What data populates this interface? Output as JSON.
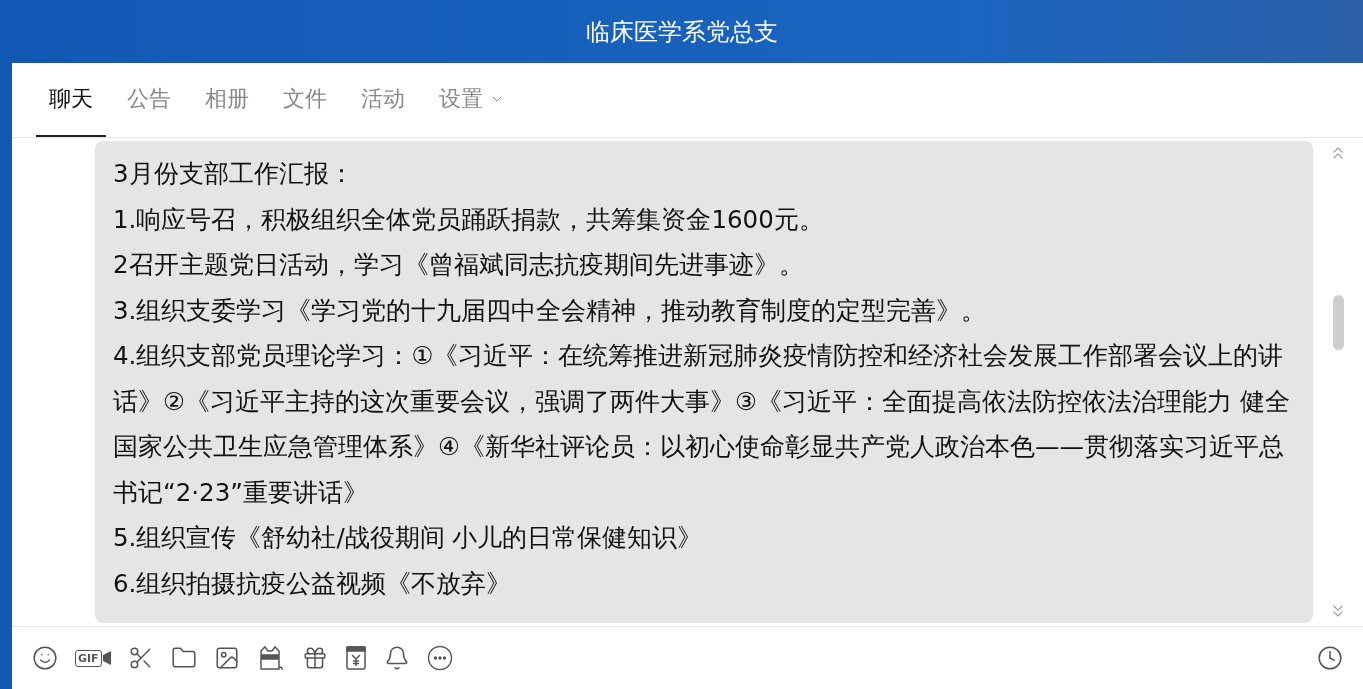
{
  "window": {
    "title": "临床医学系党总支"
  },
  "tabs": [
    {
      "label": "聊天",
      "selected": true,
      "dropdown": false
    },
    {
      "label": "公告",
      "selected": false,
      "dropdown": false
    },
    {
      "label": "相册",
      "selected": false,
      "dropdown": false
    },
    {
      "label": "文件",
      "selected": false,
      "dropdown": false
    },
    {
      "label": "活动",
      "selected": false,
      "dropdown": false
    },
    {
      "label": "设置",
      "selected": false,
      "dropdown": true
    }
  ],
  "message": {
    "lines": [
      "3月份支部工作汇报：",
      "1.响应号召，积极组织全体党员踊跃捐款，共筹集资金1600元。",
      "2召开主题党日活动，学习《曾福斌同志抗疫期间先进事迹》。",
      "3.组织支委学习《学习党的十九届四中全会精神，推动教育制度的定型完善》。",
      "4.组织支部党员理论学习：①《习近平：在统筹推进新冠肺炎疫情防控和经济社会发展工作部署会议上的讲话》②《习近平主持的这次重要会议，强调了两件大事》③《习近平：全面提高依法防控依法治理能力 健全国家公共卫生应急管理体系》④《新华社评论员：以初心使命彰显共产党人政治本色——贯彻落实习近平总书记“2·23”重要讲话》",
      "5.组织宣传《舒幼社/战役期间 小儿的日常保健知识》",
      "6.组织拍摄抗疫公益视频《不放弃》"
    ]
  },
  "toolbar": {
    "gif_label": "GIF"
  }
}
